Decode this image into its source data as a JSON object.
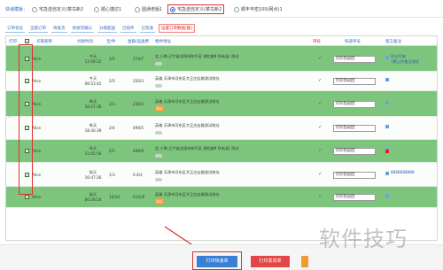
{
  "topbar": {
    "label": "快递模板：",
    "options": [
      {
        "label": "宅急送自定义(菜鸟新2",
        "selected": false
      },
      {
        "label": "顺心捷达1",
        "selected": false
      },
      {
        "label": "圆通老版1",
        "selected": false
      },
      {
        "label": "宅急送自定义(菜鸟新2",
        "selected": true
      },
      {
        "label": "顺丰丰密100(网点)1",
        "selected": false
      }
    ]
  },
  "tabs": [
    "订单状态",
    "全部订单",
    "待发货",
    "待发货确认",
    "分拣配送",
    "已揽件",
    "已签收",
    "设置订单数据(推)"
  ],
  "headers": [
    "打印",
    "",
    "买家昵称",
    "付款时间",
    "宝/件",
    "金额/运送费",
    "物件地址",
    "",
    "审核",
    "快递单号",
    "留言备注"
  ],
  "rows": [
    {
      "nick": "Alice",
      "pay_date": "今天",
      "pay_time": "13:59:22",
      "qty": "2/5",
      "amount": "274/7",
      "addr": "北   小陶  辽宁省沈阳市和平区 湖北路9 所有县/ 测试",
      "tag": "",
      "status": "✓",
      "print": "打印后返回",
      "notes": [
        "测试可能",
        "1需上传备注测试"
      ],
      "flag": false
    },
    {
      "nick": "Alice",
      "pay_date": "今天",
      "pay_time": "08:53:42",
      "qty": "2/5",
      "amount": "250/3",
      "addr": "英雄   天津市河东区大王庄店路测试地址",
      "tag": "",
      "status": "✓",
      "print": "打印后返回",
      "notes": [],
      "flag": false
    },
    {
      "nick": "Alice",
      "pay_date": "昨天",
      "pay_time": "18:27:30",
      "qty": "2/3",
      "amount": "236/3",
      "addr": "英雄   天津市河东区大王庄店路测试地址",
      "tag": "测试",
      "status": "✓",
      "print": "打印后返回",
      "notes": [],
      "flag": false
    },
    {
      "nick": "Alice",
      "pay_date": "昨天",
      "pay_time": "18:30:39",
      "qty": "2/4",
      "amount": "496/5",
      "addr": "英雄   天津市河东区大王庄店路测试地址",
      "tag": "",
      "status": "✓",
      "print": "打印后返回",
      "notes": [],
      "flag": false
    },
    {
      "nick": "Alice",
      "pay_date": "昨天",
      "pay_time": "11:05:56",
      "qty": "2/5",
      "amount": "496/9",
      "addr": "北   小陶  辽宁省沈阳市和平区 湖北路9 所有县/ 测试",
      "tag": "",
      "status": "✓",
      "print": "打印后返回",
      "notes": [],
      "flag": true
    },
    {
      "nick": "Alice",
      "pay_date": "前天",
      "pay_time": "16:47:26",
      "qty": "1/3",
      "amount": "0.4/2",
      "addr": "英雄   天津市河东区大王庄店路测试地址",
      "tag": "",
      "status": "✓",
      "print": "打印后返回",
      "notes": [
        "8888888888"
      ],
      "flag": false
    },
    {
      "nick": "Alice",
      "pay_date": "前天",
      "pay_time": "00:26:54",
      "qty": "14/14",
      "amount": "0.01/0",
      "addr": "英雄   天津市河东区大王庄店路测试地址",
      "tag": "测试",
      "status": "✓",
      "print": "打印后返回",
      "notes": [],
      "flag": false
    }
  ],
  "buttons": {
    "print_express": "打印快递单",
    "print_shipping": "打印发货单"
  },
  "watermark": "软件技巧",
  "colors": {
    "row_green": "#7dc47d",
    "primary": "#3b7ed6",
    "danger": "#e04848",
    "highlight": "#e03030"
  }
}
